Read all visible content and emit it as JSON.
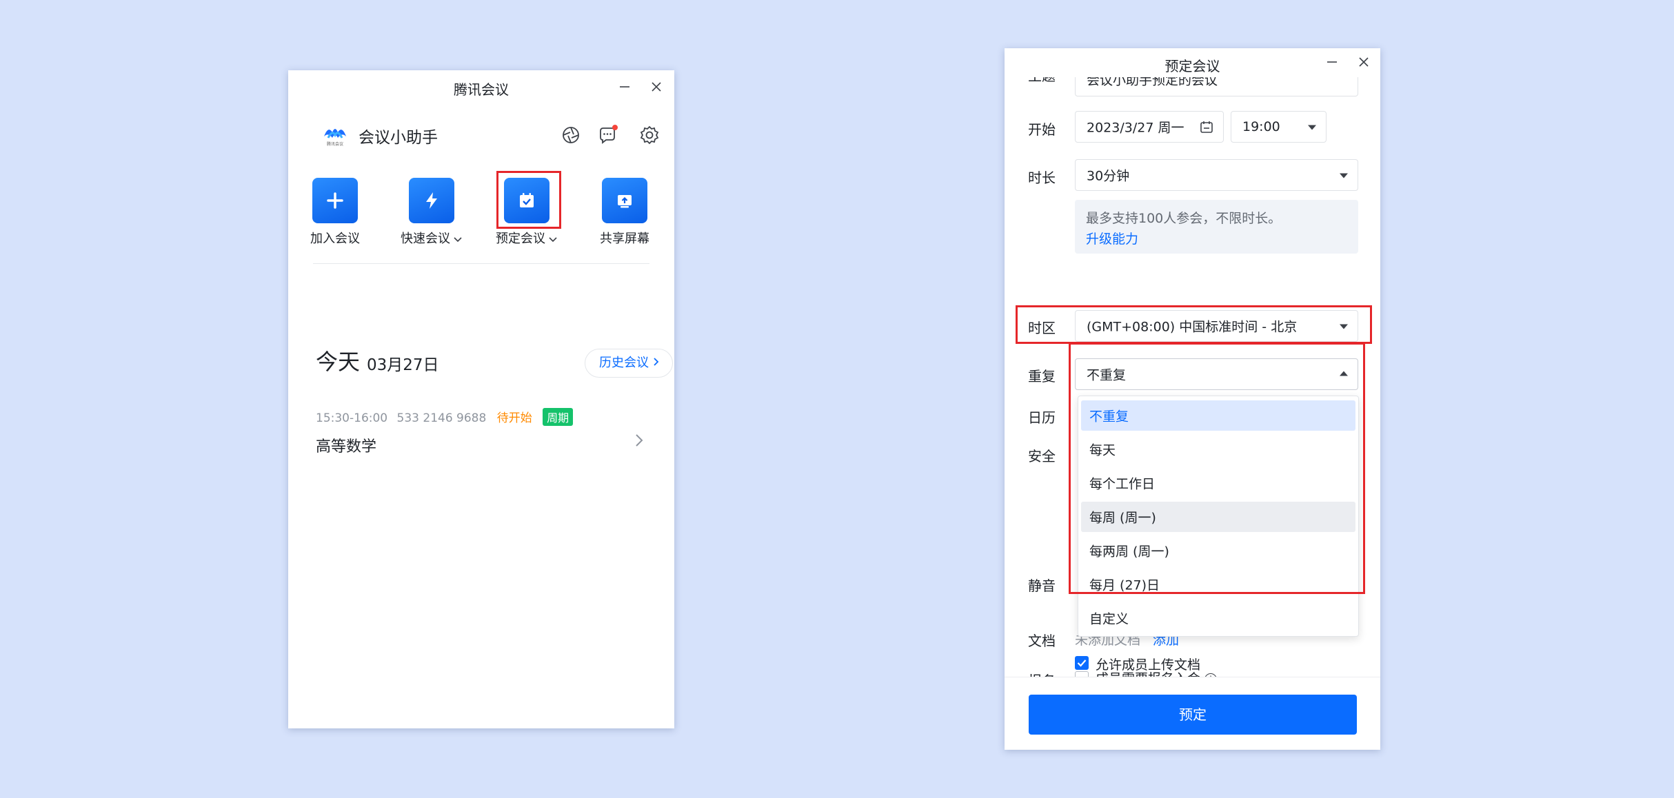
{
  "left": {
    "title": "腾讯会议",
    "logo_sub": "腾讯会议",
    "username": "会议小助手",
    "actions": [
      {
        "label": "加入会议"
      },
      {
        "label": "快速会议"
      },
      {
        "label": "预定会议"
      },
      {
        "label": "共享屏幕"
      }
    ],
    "today_label": "今天",
    "today_date": "03月27日",
    "history_button": "历史会议",
    "meeting": {
      "time": "15:30-16:00",
      "id": "533 2146 9688",
      "status": "待开始",
      "badge": "周期",
      "title": "高等数学"
    },
    "colors": {
      "accent": "#0a6cff",
      "status": "#ff8a00",
      "badge": "#15c26b",
      "highlight": "#e5262a"
    }
  },
  "right": {
    "title": "预定会议",
    "labels": {
      "subject": "主题",
      "start": "开始",
      "duration": "时长",
      "timezone": "时区",
      "repeat": "重复",
      "calendar": "日历",
      "security": "安全",
      "mute": "静音",
      "docs": "文档",
      "signup": "报名"
    },
    "subject_value": "会议小助手预定的会议",
    "start_date": "2023/3/27 周一",
    "start_time": "19:00",
    "duration_value": "30分钟",
    "info_text": "最多支持100人参会，不限时长。",
    "info_link": "升级能力",
    "timezone_value": "(GMT+08:00) 中国标准时间 - 北京",
    "repeat_value": "不重复",
    "repeat_options": [
      {
        "label": "不重复"
      },
      {
        "label": "每天"
      },
      {
        "label": "每个工作日"
      },
      {
        "label": "每周 (周一)"
      },
      {
        "label": "每两周 (周一)"
      },
      {
        "label": "每月 (27)日"
      },
      {
        "label": "自定义"
      }
    ],
    "selected_option": "不重复",
    "hovered_option": "每周 (周一)",
    "docs_none": "未添加文档",
    "docs_add": "添加",
    "allow_upload": "允许成员上传文档",
    "allow_upload_checked": true,
    "signup_required": "成员需要报名入会",
    "signup_checked": false,
    "submit": "预定"
  }
}
